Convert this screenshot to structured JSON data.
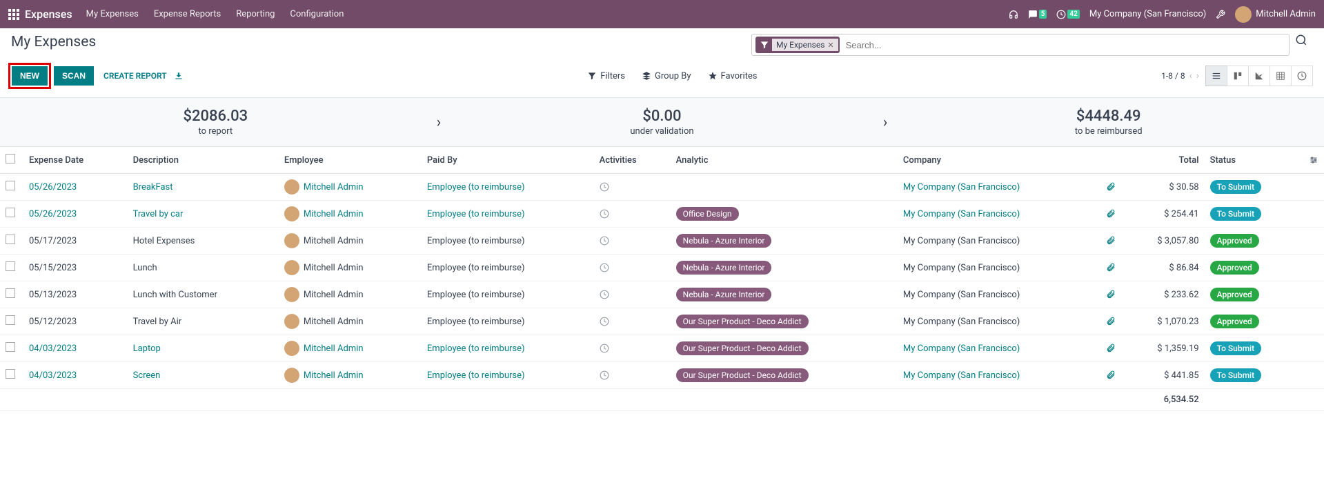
{
  "navbar": {
    "module": "Expenses",
    "items": [
      "My Expenses",
      "Expense Reports",
      "Reporting",
      "Configuration"
    ],
    "messages_badge": "5",
    "activities_badge": "42",
    "company": "My Company (San Francisco)",
    "user": "Mitchell Admin"
  },
  "page": {
    "title": "My Expenses",
    "new_btn": "NEW",
    "scan_btn": "SCAN",
    "create_report_btn": "CREATE REPORT",
    "search_chip": "My Expenses",
    "search_placeholder": "Search...",
    "filters_label": "Filters",
    "groupby_label": "Group By",
    "favorites_label": "Favorites",
    "pager": "1-8 / 8"
  },
  "summary": {
    "to_report_amount": "$2086.03",
    "to_report_label": "to report",
    "under_validation_amount": "$0.00",
    "under_validation_label": "under validation",
    "to_reimburse_amount": "$4448.49",
    "to_reimburse_label": "to be reimbursed"
  },
  "columns": {
    "date": "Expense Date",
    "description": "Description",
    "employee": "Employee",
    "paidby": "Paid By",
    "activities": "Activities",
    "analytic": "Analytic",
    "company": "Company",
    "total": "Total",
    "status": "Status"
  },
  "rows": [
    {
      "date": "05/26/2023",
      "desc": "BreakFast",
      "employee": "Mitchell Admin",
      "paidby": "Employee (to reimburse)",
      "analytic": "",
      "company": "My Company (San Francisco)",
      "total": "$ 30.58",
      "status": "To Submit",
      "status_class": "submit",
      "linked": true
    },
    {
      "date": "05/26/2023",
      "desc": "Travel by car",
      "employee": "Mitchell Admin",
      "paidby": "Employee (to reimburse)",
      "analytic": "Office Design",
      "company": "My Company (San Francisco)",
      "total": "$ 254.41",
      "status": "To Submit",
      "status_class": "submit",
      "linked": true
    },
    {
      "date": "05/17/2023",
      "desc": "Hotel Expenses",
      "employee": "Mitchell Admin",
      "paidby": "Employee (to reimburse)",
      "analytic": "Nebula - Azure Interior",
      "company": "My Company (San Francisco)",
      "total": "$ 3,057.80",
      "status": "Approved",
      "status_class": "approved",
      "linked": false
    },
    {
      "date": "05/15/2023",
      "desc": "Lunch",
      "employee": "Mitchell Admin",
      "paidby": "Employee (to reimburse)",
      "analytic": "Nebula - Azure Interior",
      "company": "My Company (San Francisco)",
      "total": "$ 86.84",
      "status": "Approved",
      "status_class": "approved",
      "linked": false
    },
    {
      "date": "05/13/2023",
      "desc": "Lunch with Customer",
      "employee": "Mitchell Admin",
      "paidby": "Employee (to reimburse)",
      "analytic": "Nebula - Azure Interior",
      "company": "My Company (San Francisco)",
      "total": "$ 233.62",
      "status": "Approved",
      "status_class": "approved",
      "linked": false
    },
    {
      "date": "05/12/2023",
      "desc": "Travel by Air",
      "employee": "Mitchell Admin",
      "paidby": "Employee (to reimburse)",
      "analytic": "Our Super Product - Deco Addict",
      "company": "My Company (San Francisco)",
      "total": "$ 1,070.23",
      "status": "Approved",
      "status_class": "approved",
      "linked": false
    },
    {
      "date": "04/03/2023",
      "desc": "Laptop",
      "employee": "Mitchell Admin",
      "paidby": "Employee (to reimburse)",
      "analytic": "Our Super Product - Deco Addict",
      "company": "My Company (San Francisco)",
      "total": "$ 1,359.19",
      "status": "To Submit",
      "status_class": "submit",
      "linked": true
    },
    {
      "date": "04/03/2023",
      "desc": "Screen",
      "employee": "Mitchell Admin",
      "paidby": "Employee (to reimburse)",
      "analytic": "Our Super Product - Deco Addict",
      "company": "My Company (San Francisco)",
      "total": "$ 441.85",
      "status": "To Submit",
      "status_class": "submit",
      "linked": true
    }
  ],
  "footer_total": "6,534.52"
}
